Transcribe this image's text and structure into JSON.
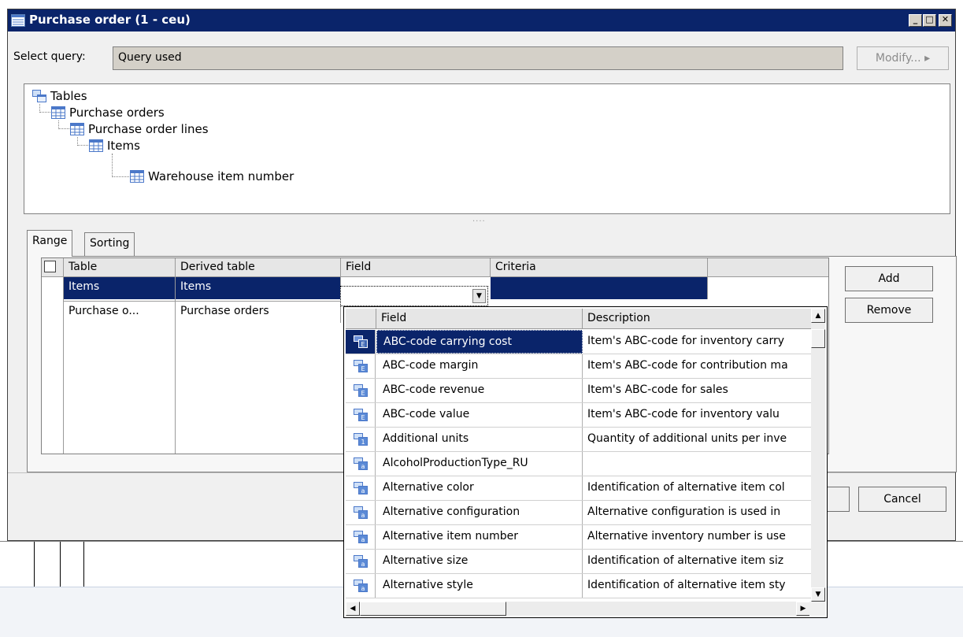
{
  "window": {
    "title": "Purchase order (1 - ceu)",
    "controls": {
      "minimize": "_",
      "maximize": "□",
      "close": "✕"
    }
  },
  "query": {
    "label": "Select query:",
    "value": "Query used",
    "modify_label": "Modify... ▸"
  },
  "tree": {
    "nodes": [
      {
        "label": "Tables",
        "icon": "tables-icon"
      },
      {
        "label": "Purchase orders",
        "icon": "table-icon"
      },
      {
        "label": "Purchase order lines",
        "icon": "table-icon"
      },
      {
        "label": "Items",
        "icon": "table-icon"
      },
      {
        "label": "Warehouse item number",
        "icon": "table-icon"
      }
    ]
  },
  "splitter": "····",
  "tabs": [
    {
      "label": "Range",
      "active": true
    },
    {
      "label": "Sorting",
      "active": false
    }
  ],
  "grid": {
    "headers": [
      "Table",
      "Derived table",
      "Field",
      "Criteria",
      ""
    ],
    "rows": [
      {
        "table": "Items",
        "derived": "Items",
        "field": "",
        "criteria": ""
      },
      {
        "table": "Purchase o...",
        "derived": "Purchase orders",
        "field": "",
        "criteria": ""
      }
    ]
  },
  "buttons": {
    "add": "Add",
    "remove": "Remove",
    "cancel": "Cancel"
  },
  "dropdown": {
    "headers": {
      "field": "Field",
      "description": "Description"
    },
    "rows": [
      {
        "field": "ABC-code carrying cost",
        "description": "Item's ABC-code for inventory carry",
        "icon": "enum-field-icon"
      },
      {
        "field": "ABC-code margin",
        "description": "Item's ABC-code for contribution ma",
        "icon": "enum-field-icon"
      },
      {
        "field": "ABC-code revenue",
        "description": "Item's ABC-code for sales",
        "icon": "enum-field-icon"
      },
      {
        "field": "ABC-code value",
        "description": "Item's ABC-code for inventory valu",
        "icon": "enum-field-icon"
      },
      {
        "field": "Additional units",
        "description": "Quantity of additional units per inve",
        "icon": "number-field-icon"
      },
      {
        "field": "AlcoholProductionType_RU",
        "description": "",
        "icon": "string-field-icon"
      },
      {
        "field": "Alternative color",
        "description": "Identification of alternative item col",
        "icon": "string-field-icon"
      },
      {
        "field": "Alternative configuration",
        "description": "Alternative configuration is used in",
        "icon": "string-field-icon"
      },
      {
        "field": "Alternative item number",
        "description": "Alternative inventory number is use",
        "icon": "string-field-icon"
      },
      {
        "field": "Alternative size",
        "description": "Identification of alternative item siz",
        "icon": "string-field-icon"
      },
      {
        "field": "Alternative style",
        "description": "Identification of alternative item sty",
        "icon": "string-field-icon"
      }
    ],
    "scroll": {
      "up": "▲",
      "down": "▼",
      "left": "◀",
      "right": "▶"
    }
  },
  "colors": {
    "title_bar": "#0a246a",
    "selection": "#0a246a",
    "window_bg": "#f0f0f0"
  }
}
